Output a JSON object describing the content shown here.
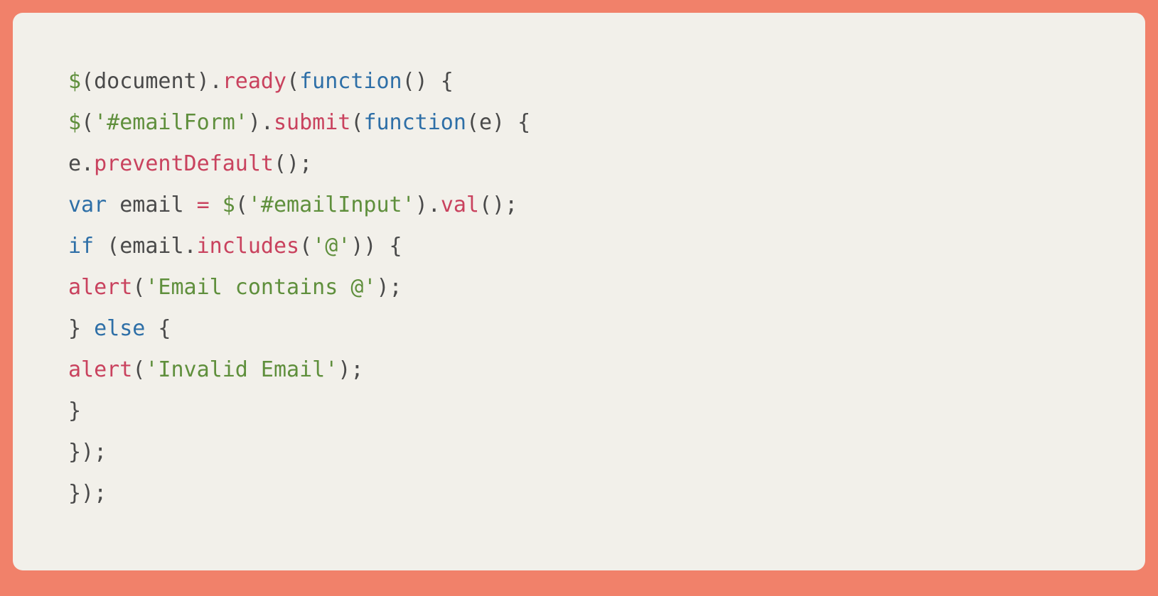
{
  "code": {
    "lines": [
      [
        {
          "t": "$",
          "c": "c-dollar"
        },
        {
          "t": "(",
          "c": "c-default"
        },
        {
          "t": "document",
          "c": "c-default"
        },
        {
          "t": ").",
          "c": "c-default"
        },
        {
          "t": "ready",
          "c": "c-method"
        },
        {
          "t": "(",
          "c": "c-default"
        },
        {
          "t": "function",
          "c": "c-keyword"
        },
        {
          "t": "() {",
          "c": "c-default"
        }
      ],
      [
        {
          "t": "$",
          "c": "c-dollar"
        },
        {
          "t": "(",
          "c": "c-default"
        },
        {
          "t": "'#emailForm'",
          "c": "c-string"
        },
        {
          "t": ").",
          "c": "c-default"
        },
        {
          "t": "submit",
          "c": "c-method"
        },
        {
          "t": "(",
          "c": "c-default"
        },
        {
          "t": "function",
          "c": "c-keyword"
        },
        {
          "t": "(e) {",
          "c": "c-default"
        }
      ],
      [
        {
          "t": "e.",
          "c": "c-default"
        },
        {
          "t": "preventDefault",
          "c": "c-method"
        },
        {
          "t": "();",
          "c": "c-default"
        }
      ],
      [
        {
          "t": "var",
          "c": "c-keyword"
        },
        {
          "t": " email ",
          "c": "c-default"
        },
        {
          "t": "=",
          "c": "c-method"
        },
        {
          "t": " ",
          "c": "c-default"
        },
        {
          "t": "$",
          "c": "c-dollar"
        },
        {
          "t": "(",
          "c": "c-default"
        },
        {
          "t": "'#emailInput'",
          "c": "c-string"
        },
        {
          "t": ").",
          "c": "c-default"
        },
        {
          "t": "val",
          "c": "c-method"
        },
        {
          "t": "();",
          "c": "c-default"
        }
      ],
      [
        {
          "t": "if",
          "c": "c-keyword"
        },
        {
          "t": " (email.",
          "c": "c-default"
        },
        {
          "t": "includes",
          "c": "c-method"
        },
        {
          "t": "(",
          "c": "c-default"
        },
        {
          "t": "'@'",
          "c": "c-string"
        },
        {
          "t": ")) {",
          "c": "c-default"
        }
      ],
      [
        {
          "t": "alert",
          "c": "c-method"
        },
        {
          "t": "(",
          "c": "c-default"
        },
        {
          "t": "'Email contains @'",
          "c": "c-string"
        },
        {
          "t": ");",
          "c": "c-default"
        }
      ],
      [
        {
          "t": "} ",
          "c": "c-default"
        },
        {
          "t": "else",
          "c": "c-keyword"
        },
        {
          "t": " {",
          "c": "c-default"
        }
      ],
      [
        {
          "t": "alert",
          "c": "c-method"
        },
        {
          "t": "(",
          "c": "c-default"
        },
        {
          "t": "'Invalid Email'",
          "c": "c-string"
        },
        {
          "t": ");",
          "c": "c-default"
        }
      ],
      [
        {
          "t": "}",
          "c": "c-default"
        }
      ],
      [
        {
          "t": "});",
          "c": "c-default"
        }
      ],
      [
        {
          "t": "});",
          "c": "c-default"
        }
      ]
    ]
  }
}
